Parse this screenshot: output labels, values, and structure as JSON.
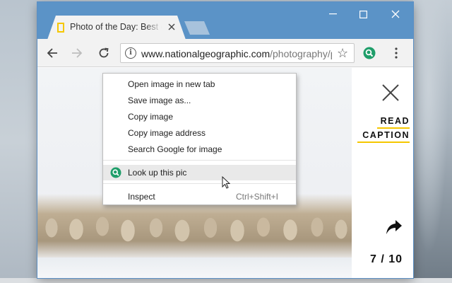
{
  "browser": {
    "tab_title": "Photo of the Day: Best of",
    "url_host": "www.nationalgeographic.com",
    "url_path": "/photography/pro"
  },
  "viewer": {
    "read_label": "READ",
    "caption_label": "CAPTION",
    "counter": "7 / 10"
  },
  "context_menu": {
    "items": [
      {
        "label": "Open image in new tab"
      },
      {
        "label": "Save image as..."
      },
      {
        "label": "Copy image"
      },
      {
        "label": "Copy image address"
      },
      {
        "label": "Search Google for image"
      },
      {
        "label": "Look up this pic"
      },
      {
        "label": "Inspect",
        "shortcut": "Ctrl+Shift+I"
      }
    ]
  },
  "icons": {
    "window_controls": [
      "minimize-icon",
      "maximize-icon",
      "close-icon"
    ],
    "toolbar": [
      "back-arrow-icon",
      "forward-arrow-icon",
      "reload-icon",
      "info-icon",
      "star-icon",
      "extension-magnifier-icon",
      "kebab-menu-icon"
    ],
    "viewer": [
      "close-x-icon",
      "share-arrow-icon"
    ],
    "menu": [
      "look-up-magnifier-icon"
    ]
  },
  "colors": {
    "titlebar": "#5b93c7",
    "caption_underline": "#f5c700",
    "extension_green": "#1f9e6a"
  }
}
